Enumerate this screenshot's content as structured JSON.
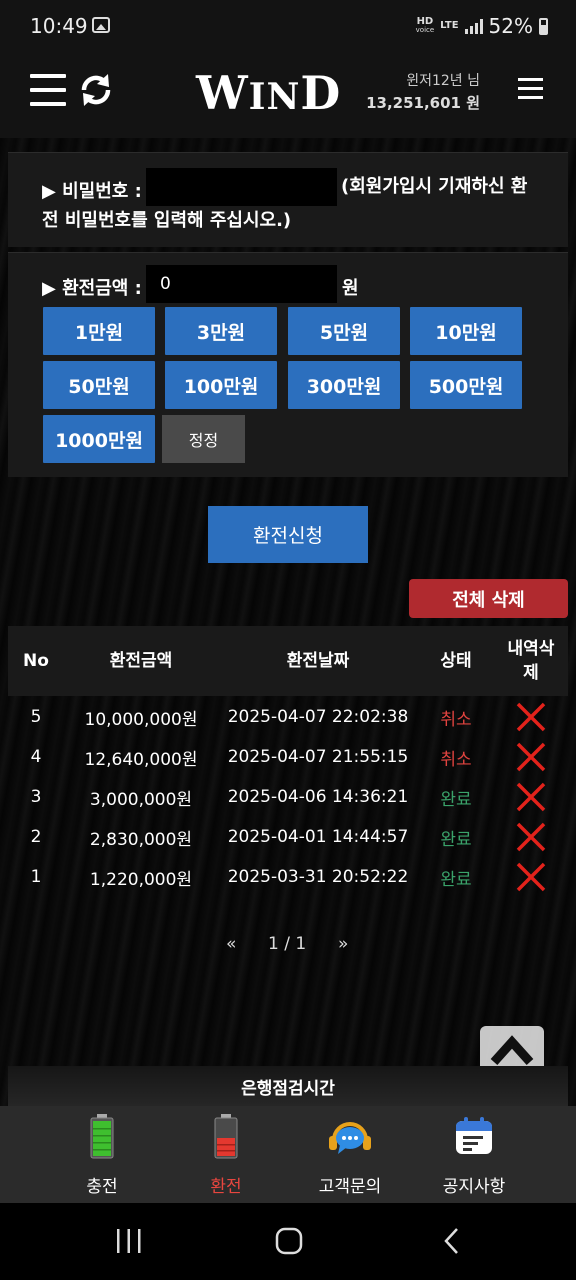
{
  "status_bar": {
    "time": "10:49",
    "hd_top": "HD",
    "hd_bottom": "voice",
    "lte": "LTE",
    "battery": "52%"
  },
  "header": {
    "logo_big1": "W",
    "logo_small1": "IN",
    "logo_big2": "D",
    "user": "윈저12년 님",
    "balance": "13,251,601 원"
  },
  "password": {
    "label": "▶ 비밀번호 :",
    "value": "",
    "note_line1": "(회원가입시 기재하신 환",
    "note_line2": "전 비밀번호를 입력해 주십시오.)"
  },
  "amount": {
    "label": "▶ 환전금액 :",
    "value": "0",
    "unit": "원"
  },
  "amount_buttons": [
    "1만원",
    "3만원",
    "5만원",
    "10만원",
    "50만원",
    "100만원",
    "300만원",
    "500만원",
    "1000만원"
  ],
  "reset_label": "정정",
  "submit_label": "환전신청",
  "delete_all_label": "전체 삭제",
  "table": {
    "headers": {
      "no": "No",
      "amount": "환전금액",
      "date": "환전날짜",
      "status": "상태",
      "delete_line1": "내역삭",
      "delete_line2": "제"
    },
    "rows": [
      {
        "no": "5",
        "amount": "10,000,000원",
        "date": "2025-04-07 22:02:38",
        "status": "취소",
        "status_color": "#e0433f"
      },
      {
        "no": "4",
        "amount": "12,640,000원",
        "date": "2025-04-07 21:55:15",
        "status": "취소",
        "status_color": "#e0433f"
      },
      {
        "no": "3",
        "amount": "3,000,000원",
        "date": "2025-04-06 14:36:21",
        "status": "완료",
        "status_color": "#3aa36a"
      },
      {
        "no": "2",
        "amount": "2,830,000원",
        "date": "2025-04-01 14:44:57",
        "status": "완료",
        "status_color": "#3aa36a"
      },
      {
        "no": "1",
        "amount": "1,220,000원",
        "date": "2025-03-31 20:52:22",
        "status": "완료",
        "status_color": "#3aa36a"
      }
    ]
  },
  "pagination": {
    "prev": "«",
    "current": "1 / 1",
    "next": "»"
  },
  "bank_maintenance": "은행점검시간",
  "bottom_nav": [
    {
      "label": "충전",
      "icon": "battery-full-icon",
      "active": false
    },
    {
      "label": "환전",
      "icon": "battery-low-icon",
      "active": true
    },
    {
      "label": "고객문의",
      "icon": "headset-chat-icon",
      "active": false
    },
    {
      "label": "공지사항",
      "icon": "notice-calendar-icon",
      "active": false
    }
  ],
  "colors": {
    "primary_blue": "#2c6fbe",
    "danger_red": "#b02a2f",
    "panel": "#1a1a1a",
    "active_nav": "#e8463f"
  }
}
